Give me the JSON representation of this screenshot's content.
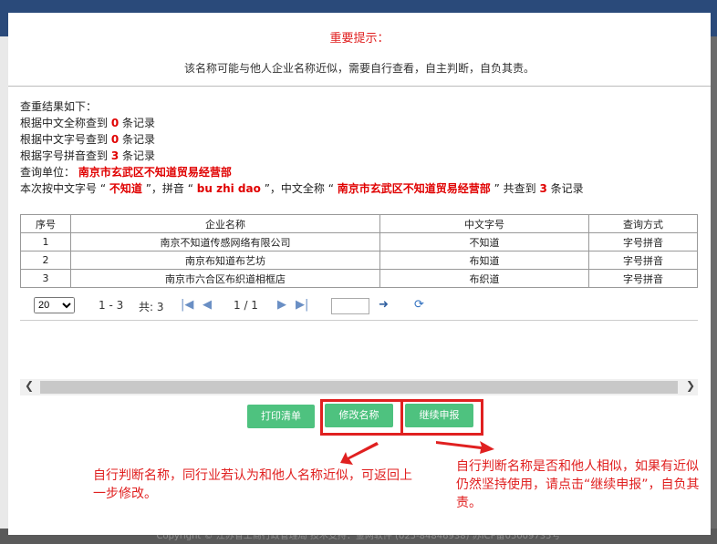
{
  "background": {
    "footer_text": "Copyright © 江苏省工商行政管理局  技术支持：金网软件 (025-84846938)  苏ICP备05009735号"
  },
  "modal": {
    "title": "重要提示：",
    "subtitle": "该名称可能与他人企业名称近似，需要自行查看，自主判断，自负其责。"
  },
  "results": {
    "heading": "查重结果如下：",
    "line1_pre": "根据中文全称查到",
    "line1_count": "0",
    "line1_post": "条记录",
    "line2_pre": "根据中文字号查到",
    "line2_count": "0",
    "line2_post": "条记录",
    "line3_pre": "根据字号拼音查到",
    "line3_count": "3",
    "line3_post": "条记录",
    "unit_label": "查询单位：",
    "unit_name": "南京市玄武区不知道贸易经营部",
    "summary_pre": "本次按中文字号 “",
    "summary_zihao": "不知道",
    "summary_mid1": "”，拼音 “",
    "summary_pinyin": "bu zhi dao",
    "summary_mid2": "”，中文全称 “",
    "summary_fullname": "南京市玄武区不知道贸易经营部",
    "summary_mid3": "” 共查到",
    "summary_count": "3",
    "summary_post": "条记录"
  },
  "table": {
    "headers": [
      "序号",
      "企业名称",
      "中文字号",
      "查询方式"
    ],
    "rows": [
      [
        "1",
        "南京不知道传感网络有限公司",
        "不知道",
        "字号拼音"
      ],
      [
        "2",
        "南京布知道布艺坊",
        "布知道",
        "字号拼音"
      ],
      [
        "3",
        "南京市六合区布织道相框店",
        "布织道",
        "字号拼音"
      ]
    ]
  },
  "pager": {
    "page_size": "20",
    "range": "1 - 3",
    "total": "共: 3",
    "page": "1 / 1"
  },
  "buttons": {
    "print": "打印清单",
    "modify": "修改名称",
    "continue": "继续申报"
  },
  "annotations": {
    "left_note": "自行判断名称，同行业若认为和他人名称近似，可返回上一步修改。",
    "right_note": "自行判断名称是否和他人相似，如果有近似仍然坚持使用，请点击“继续申报”，自负其责。"
  },
  "colors": {
    "accent_red": "#e02020",
    "button_green": "#4ec27f"
  }
}
